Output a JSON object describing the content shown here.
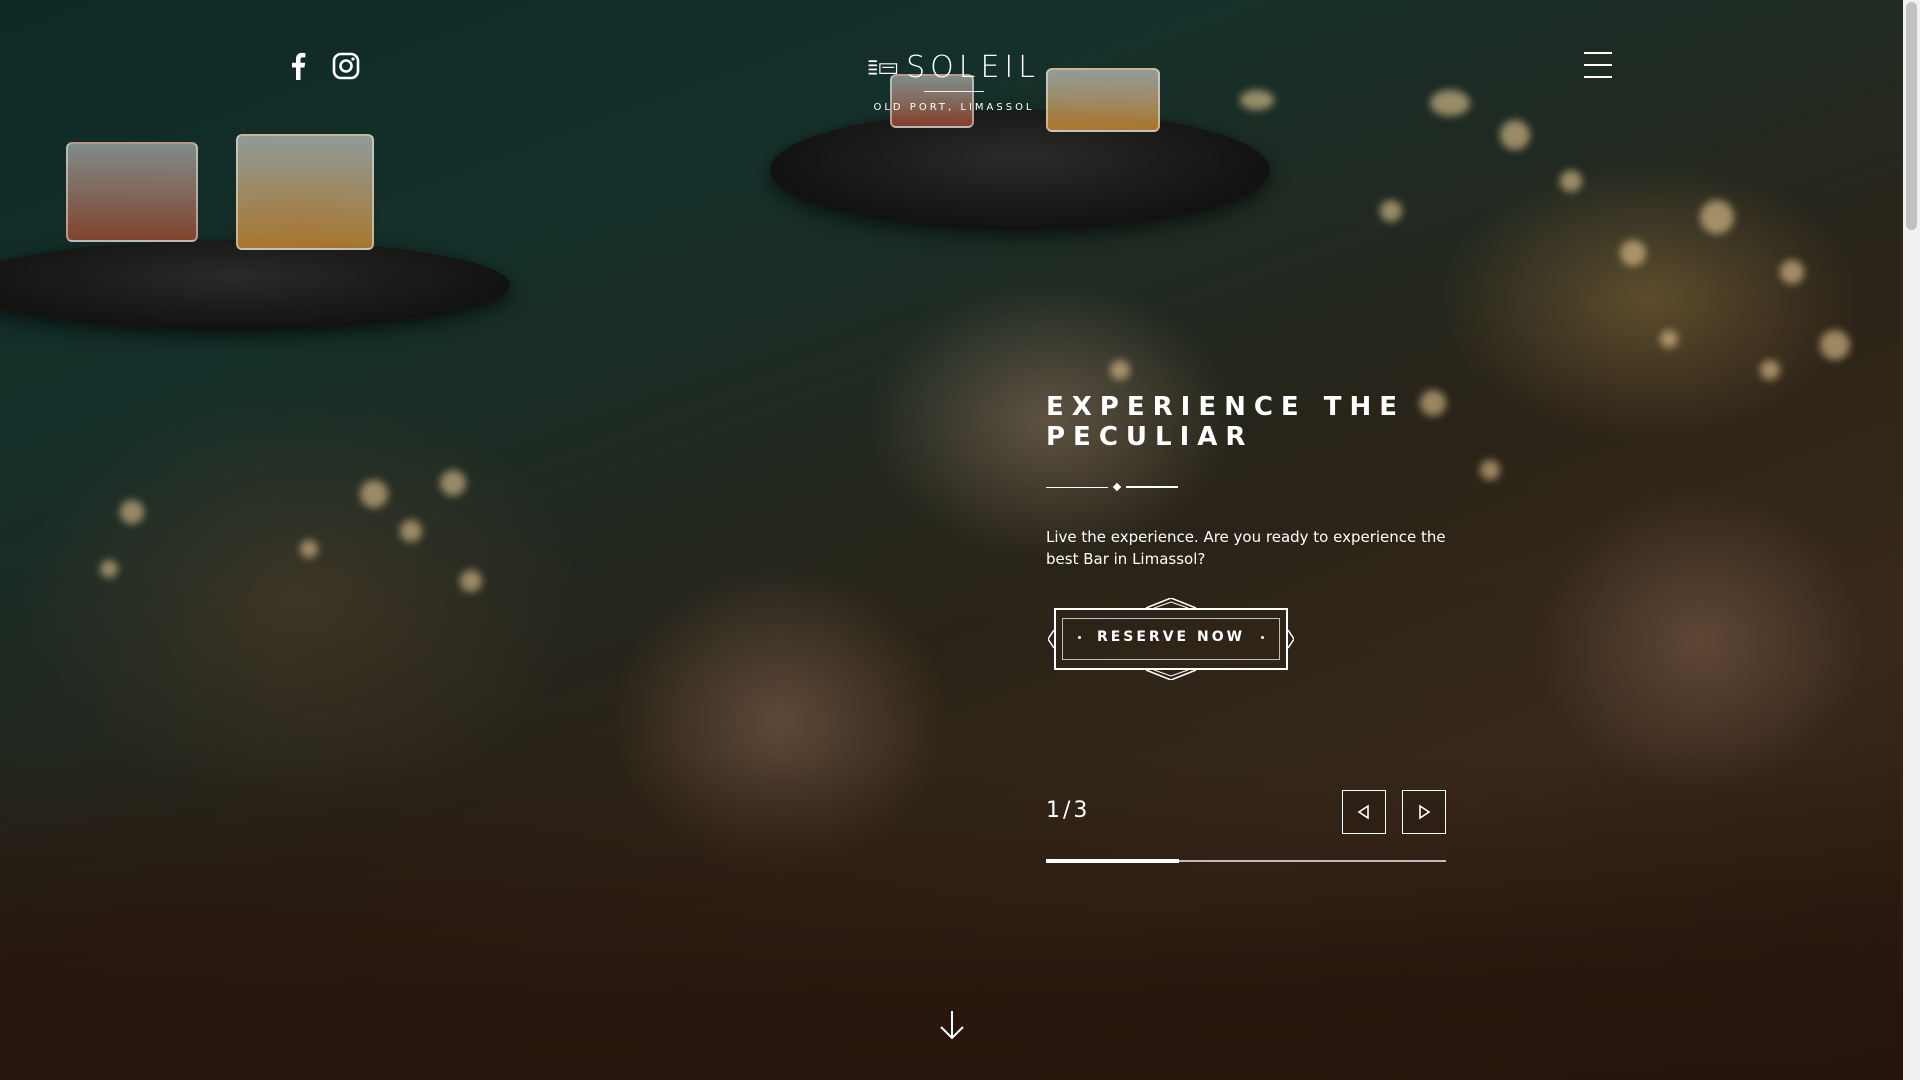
{
  "header": {
    "social": [
      {
        "name": "facebook-icon"
      },
      {
        "name": "instagram-icon"
      }
    ],
    "logo": {
      "wordmark": "SOLEIL",
      "tagline": "OLD PORT, LIMASSOL"
    },
    "menu_icon": "hamburger-menu-icon"
  },
  "slide": {
    "title": "EXPERIENCE THE PECULIAR",
    "description": "Live the experience. Are you ready to experience the best Bar in Limassol?",
    "cta_label": "RESERVE NOW",
    "counter": "1/3",
    "current": 1,
    "total": 3,
    "progress": 0.3333
  },
  "controls": {
    "prev_icon": "arrow-left-icon",
    "next_icon": "arrow-right-icon",
    "scroll_icon": "arrow-down-icon"
  },
  "colors": {
    "accent": "#ffffff",
    "footer_brown": "#26140c"
  }
}
